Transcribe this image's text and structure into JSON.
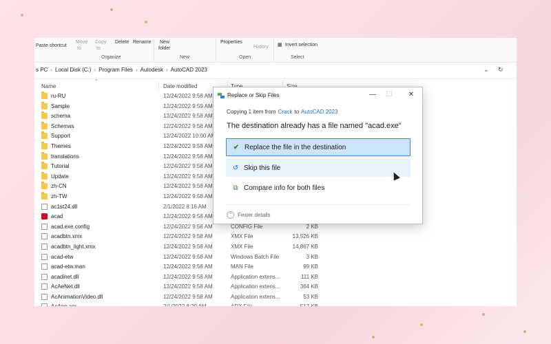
{
  "ribbon": {
    "paste_shortcut": "Paste shortcut",
    "move_to": "Move",
    "move_to2": "to",
    "copy_to": "Copy",
    "copy_to2": "to",
    "delete": "Delete",
    "rename": "Rename",
    "new_folder": "New",
    "new_folder2": "folder",
    "properties": "Properties",
    "history": "History",
    "invert_selection": "Invert selection",
    "groups": {
      "organize": "Organize",
      "new": "New",
      "open": "Open",
      "select": "Select"
    }
  },
  "breadcrumb": [
    "s PC",
    "Local Disk (C:)",
    "Program Files",
    "Autodesk",
    "AutoCAD 2023"
  ],
  "columns": {
    "name": "Name",
    "date": "Date modified",
    "type": "Type",
    "size": "Size"
  },
  "files": [
    {
      "name": "ru-RU",
      "date": "12/24/2022 9:58 AM",
      "type": "",
      "size": "",
      "kind": "folder"
    },
    {
      "name": "Sample",
      "date": "12/24/2022 9:59 AM",
      "type": "",
      "size": "",
      "kind": "folder"
    },
    {
      "name": "schema",
      "date": "12/24/2022 9:58 AM",
      "type": "",
      "size": "",
      "kind": "folder"
    },
    {
      "name": "Schemas",
      "date": "12/24/2022 9:58 AM",
      "type": "",
      "size": "",
      "kind": "folder"
    },
    {
      "name": "Support",
      "date": "12/24/2022 10:00 AM",
      "type": "",
      "size": "",
      "kind": "folder"
    },
    {
      "name": "Themes",
      "date": "12/24/2022 9:58 AM",
      "type": "",
      "size": "",
      "kind": "folder"
    },
    {
      "name": "translations",
      "date": "12/24/2022 9:58 AM",
      "type": "",
      "size": "",
      "kind": "folder"
    },
    {
      "name": "Tutorial",
      "date": "12/24/2022 9:58 AM",
      "type": "",
      "size": "",
      "kind": "folder"
    },
    {
      "name": "Update",
      "date": "12/24/2022 9:58 AM",
      "type": "",
      "size": "",
      "kind": "folder"
    },
    {
      "name": "zh-CN",
      "date": "12/24/2022 9:58 AM",
      "type": "",
      "size": "",
      "kind": "folder"
    },
    {
      "name": "zh-TW",
      "date": "12/24/2022 9:58 AM",
      "type": "",
      "size": "",
      "kind": "folder"
    },
    {
      "name": "ac1st24.dll",
      "date": "2/1/2022 8:16 AM",
      "type": "",
      "size": "",
      "kind": "file"
    },
    {
      "name": "acad",
      "date": "12/24/2022 9:58 AM",
      "type": "",
      "size": "",
      "kind": "exe"
    },
    {
      "name": "acad.exe.config",
      "date": "12/24/2022 9:58 AM",
      "type": "CONFIG File",
      "size": "2 KB",
      "kind": "file"
    },
    {
      "name": "acadbtn.xmx",
      "date": "12/24/2022 9:58 AM",
      "type": "XMX File",
      "size": "13,526 KB",
      "kind": "file"
    },
    {
      "name": "acadbtn_light.xmx",
      "date": "12/24/2022 9:58 AM",
      "type": "XMX File",
      "size": "14,867 KB",
      "kind": "file"
    },
    {
      "name": "acad-etw",
      "date": "12/24/2022 9:58 AM",
      "type": "Windows Batch File",
      "size": "3 KB",
      "kind": "file"
    },
    {
      "name": "acad-etw.man",
      "date": "12/24/2022 9:58 AM",
      "type": "MAN File",
      "size": "99 KB",
      "kind": "file"
    },
    {
      "name": "acadinet.dll",
      "date": "12/24/2022 9:58 AM",
      "type": "Application extens...",
      "size": "111 KB",
      "kind": "file"
    },
    {
      "name": "AcAeNet.dll",
      "date": "12/24/2022 9:58 AM",
      "type": "Application extens...",
      "size": "364 KB",
      "kind": "file"
    },
    {
      "name": "AcAnimationVideo.dll",
      "date": "12/24/2022 9:58 AM",
      "type": "Application extens...",
      "size": "53 KB",
      "kind": "file"
    },
    {
      "name": "AcApp.arx",
      "date": "2/1/2022 8:29 AM",
      "type": "ARX File",
      "size": "517 KB",
      "kind": "file"
    }
  ],
  "dialog": {
    "title": "Replace or Skip Files",
    "copying_prefix": "Copying 1 item from",
    "source": "Crack",
    "to": "to",
    "destination": "AutoCAD 2023",
    "heading": "The destination already has a file named \"acad.exe\"",
    "option_replace": "Replace the file in the destination",
    "option_skip": "Skip this file",
    "option_compare": "Compare info for both files",
    "fewer_details": "Fewer details",
    "btn_minimize": "—",
    "btn_maximize": "☐",
    "btn_close": "✕"
  }
}
